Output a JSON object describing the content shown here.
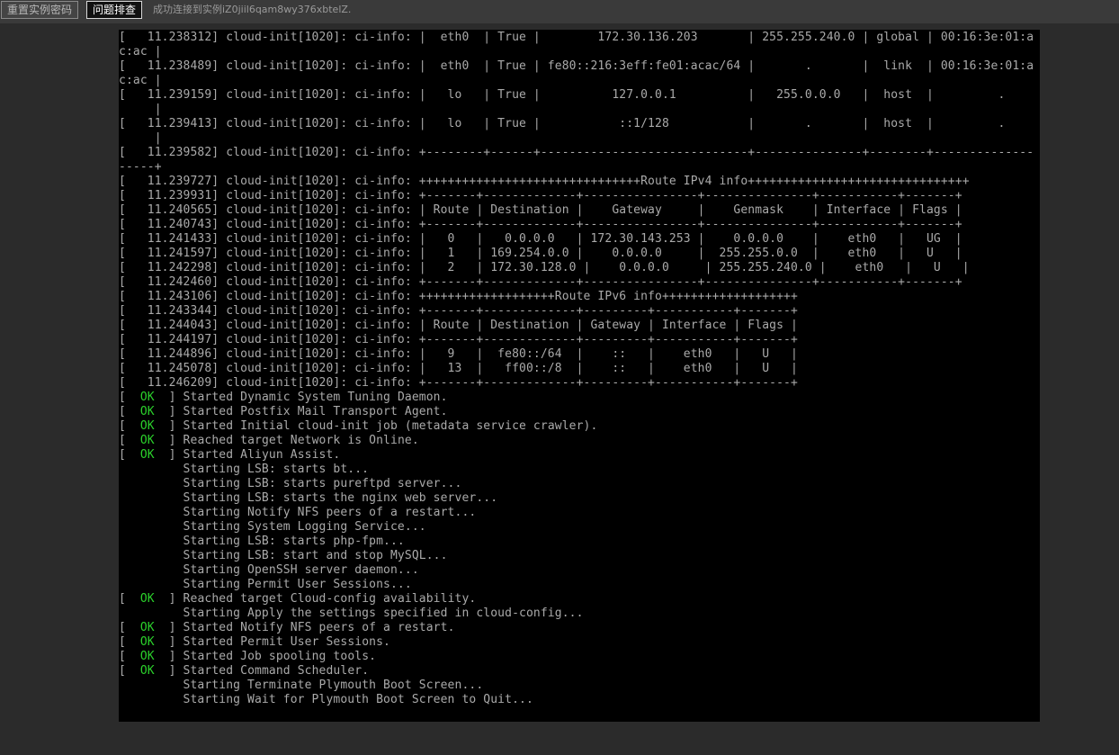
{
  "toolbar": {
    "reset_password_label": "重置实例密码",
    "diagnose_label": "问题排查",
    "status_message": "成功连接到实例iZ0jiil6qam8wy376xbtelZ."
  },
  "colors": {
    "page_background": "#2b2b2b",
    "terminal_background": "#000000",
    "terminal_text": "#aaaaaa",
    "ok_green": "#2bd12b"
  },
  "terminal": {
    "lines": [
      {
        "text": "[   11.238312] cloud-init[1020]: ci-info: |  eth0  | True |        172.30.136.203       | 255.255.240.0 | global | 00:16:3e:01:a"
      },
      {
        "text": "c:ac |"
      },
      {
        "text": "[   11.238489] cloud-init[1020]: ci-info: |  eth0  | True | fe80::216:3eff:fe01:acac/64 |       .       |  link  | 00:16:3e:01:a"
      },
      {
        "text": "c:ac |"
      },
      {
        "text": "[   11.239159] cloud-init[1020]: ci-info: |   lo   | True |          127.0.0.1          |   255.0.0.0   |  host  |         ."
      },
      {
        "text": "     |"
      },
      {
        "text": "[   11.239413] cloud-init[1020]: ci-info: |   lo   | True |           ::1/128           |       .       |  host  |         ."
      },
      {
        "text": "     |"
      },
      {
        "text": "[   11.239582] cloud-init[1020]: ci-info: +--------+------+-----------------------------+---------------+--------+--------------"
      },
      {
        "text": "-----+"
      },
      {
        "text": "[   11.239727] cloud-init[1020]: ci-info: +++++++++++++++++++++++++++++++Route IPv4 info+++++++++++++++++++++++++++++++"
      },
      {
        "text": "[   11.239931] cloud-init[1020]: ci-info: +-------+-------------+----------------+---------------+-----------+-------+"
      },
      {
        "text": "[   11.240565] cloud-init[1020]: ci-info: | Route | Destination |    Gateway     |    Genmask    | Interface | Flags |"
      },
      {
        "text": "[   11.240743] cloud-init[1020]: ci-info: +-------+-------------+----------------+---------------+-----------+-------+"
      },
      {
        "text": "[   11.241433] cloud-init[1020]: ci-info: |   0   |   0.0.0.0   | 172.30.143.253 |    0.0.0.0    |    eth0   |   UG  |"
      },
      {
        "text": "[   11.241597] cloud-init[1020]: ci-info: |   1   | 169.254.0.0 |    0.0.0.0     |  255.255.0.0  |    eth0   |   U   |"
      },
      {
        "text": "[   11.242298] cloud-init[1020]: ci-info: |   2   | 172.30.128.0 |    0.0.0.0     | 255.255.240.0 |    eth0   |   U   |"
      },
      {
        "text": "[   11.242460] cloud-init[1020]: ci-info: +-------+-------------+----------------+---------------+-----------+-------+"
      },
      {
        "text": "[   11.243106] cloud-init[1020]: ci-info: +++++++++++++++++++Route IPv6 info+++++++++++++++++++"
      },
      {
        "text": "[   11.243344] cloud-init[1020]: ci-info: +-------+-------------+---------+-----------+-------+"
      },
      {
        "text": "[   11.244043] cloud-init[1020]: ci-info: | Route | Destination | Gateway | Interface | Flags |"
      },
      {
        "text": "[   11.244197] cloud-init[1020]: ci-info: +-------+-------------+---------+-----------+-------+"
      },
      {
        "text": "[   11.244896] cloud-init[1020]: ci-info: |   9   |  fe80::/64  |    ::   |    eth0   |   U   |"
      },
      {
        "text": "[   11.245078] cloud-init[1020]: ci-info: |   13  |   ff00::/8  |    ::   |    eth0   |   U   |"
      },
      {
        "text": "[   11.246209] cloud-init[1020]: ci-info: +-------+-------------+---------+-----------+-------+"
      },
      {
        "ok": true,
        "text": "Started Dynamic System Tuning Daemon."
      },
      {
        "ok": true,
        "text": "Started Postfix Mail Transport Agent."
      },
      {
        "ok": true,
        "text": "Started Initial cloud-init job (metadata service crawler)."
      },
      {
        "ok": true,
        "text": "Reached target Network is Online."
      },
      {
        "ok": true,
        "text": "Started Aliyun Assist."
      },
      {
        "text": "         Starting LSB: starts bt..."
      },
      {
        "text": "         Starting LSB: starts pureftpd server..."
      },
      {
        "text": "         Starting LSB: starts the nginx web server..."
      },
      {
        "text": "         Starting Notify NFS peers of a restart..."
      },
      {
        "text": "         Starting System Logging Service..."
      },
      {
        "text": "         Starting LSB: starts php-fpm..."
      },
      {
        "text": "         Starting LSB: start and stop MySQL..."
      },
      {
        "text": "         Starting OpenSSH server daemon..."
      },
      {
        "text": "         Starting Permit User Sessions..."
      },
      {
        "ok": true,
        "text": "Reached target Cloud-config availability."
      },
      {
        "text": "         Starting Apply the settings specified in cloud-config..."
      },
      {
        "ok": true,
        "text": "Started Notify NFS peers of a restart."
      },
      {
        "ok": true,
        "text": "Started Permit User Sessions."
      },
      {
        "ok": true,
        "text": "Started Job spooling tools."
      },
      {
        "ok": true,
        "text": "Started Command Scheduler."
      },
      {
        "text": "         Starting Terminate Plymouth Boot Screen..."
      },
      {
        "text": "         Starting Wait for Plymouth Boot Screen to Quit..."
      }
    ],
    "ok_open": "[  ",
    "ok_word": "OK",
    "ok_close": "  ] "
  }
}
